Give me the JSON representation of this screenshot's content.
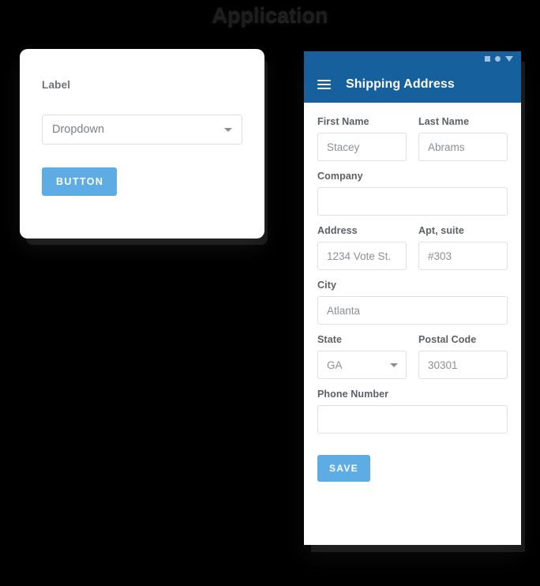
{
  "page": {
    "title": "Application",
    "background_color": "#000000"
  },
  "colors": {
    "accent_blue": "#5dace4",
    "appbar_blue": "#16609e",
    "border_gray": "#dedfe1",
    "label_gray": "#5c6165",
    "value_gray": "#8b9095"
  },
  "desktop_card": {
    "label": "Label",
    "dropdown": {
      "name": "dropdown",
      "value": "Dropdown",
      "caret_icon": "chevron-down-icon"
    },
    "button": {
      "label": "BUTTON"
    }
  },
  "phone": {
    "appbar": {
      "menu_icon": "hamburger-menu-icon",
      "title": "Shipping Address",
      "status_icons": [
        "square-icon",
        "circle-icon",
        "triangle-down-icon"
      ]
    },
    "form": {
      "fields": [
        {
          "label": "First Name",
          "value": "Stacey",
          "type": "text",
          "layout": "half"
        },
        {
          "label": "Last Name",
          "value": "Abrams",
          "type": "text",
          "layout": "half"
        },
        {
          "label": "Company",
          "value": "",
          "type": "text",
          "layout": "full"
        },
        {
          "label": "Address",
          "value": "1234 Vote St.",
          "type": "text",
          "layout": "half"
        },
        {
          "label": "Apt, suite",
          "value": "#303",
          "type": "text",
          "layout": "half"
        },
        {
          "label": "City",
          "value": "Atlanta",
          "type": "text",
          "layout": "full"
        },
        {
          "label": "State",
          "value": "GA",
          "type": "dropdown",
          "layout": "half"
        },
        {
          "label": "Postal Code",
          "value": "30301",
          "type": "text",
          "layout": "half"
        },
        {
          "label": "Phone Number",
          "value": "",
          "type": "text",
          "layout": "full"
        }
      ],
      "save_button": {
        "label": "SAVE"
      }
    }
  }
}
